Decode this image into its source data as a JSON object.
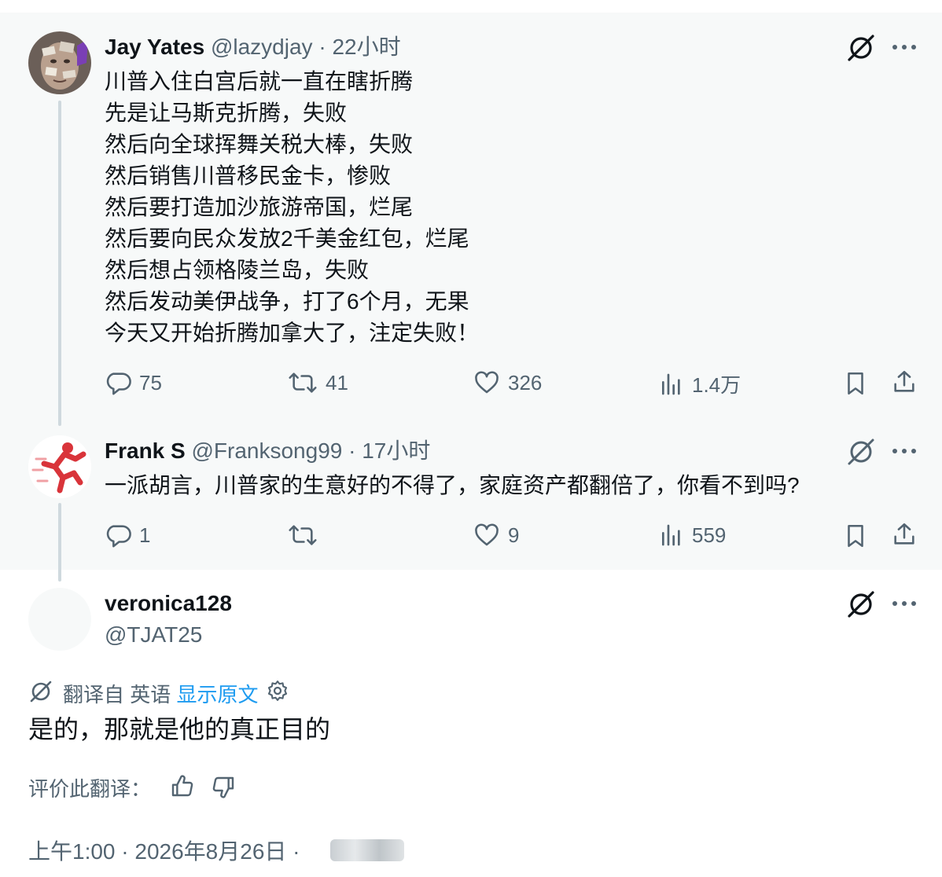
{
  "tweet1": {
    "name": "Jay Yates",
    "handle": "@lazydjay",
    "time": "22小时",
    "lines": [
      "川普入住白宫后就一直在瞎折腾",
      "先是让马斯克折腾，失败",
      "然后向全球挥舞关税大棒，失败",
      "然后销售川普移民金卡，惨败",
      "然后要打造加沙旅游帝国，烂尾",
      "然后要向民众发放2千美金红包，烂尾",
      "然后想占领格陵兰岛，失败",
      "然后发动美伊战争，打了6个月，无果",
      "今天又开始折腾加拿大了，注定失败！"
    ],
    "replies": "75",
    "retweets": "41",
    "likes": "326",
    "views": "1.4万"
  },
  "tweet2": {
    "name": "Frank S",
    "handle": "@Franksong99",
    "time": "17小时",
    "text": "一派胡言，川普家的生意好的不得了，家庭资产都翻倍了，你看不到吗?",
    "replies": "1",
    "retweets": "",
    "likes": "9",
    "views": "559"
  },
  "tweet3": {
    "name": "veronica128",
    "handle": "@TJAT25",
    "translated_from": "翻译自 英语",
    "show_original": "显示原文",
    "text": "是的，那就是他的真正目的",
    "rate_label": "评价此翻译：",
    "timestamp": "上午1:00 · 2026年8月26日 ·"
  },
  "icons": {
    "translate": "translate-icon",
    "more": "more-icon",
    "reply": "reply-icon",
    "retweet": "retweet-icon",
    "like": "like-icon",
    "views": "views-icon",
    "bookmark": "bookmark-icon",
    "share": "share-icon",
    "settings": "gear-icon",
    "thumbs_up": "thumbs-up-icon",
    "thumbs_down": "thumbs-down-icon"
  },
  "colors": {
    "text": "#0f1419",
    "secondary": "#536471",
    "link": "#1d9bf0",
    "thread_line": "#cfd9de",
    "band": "#f7f9f9"
  }
}
